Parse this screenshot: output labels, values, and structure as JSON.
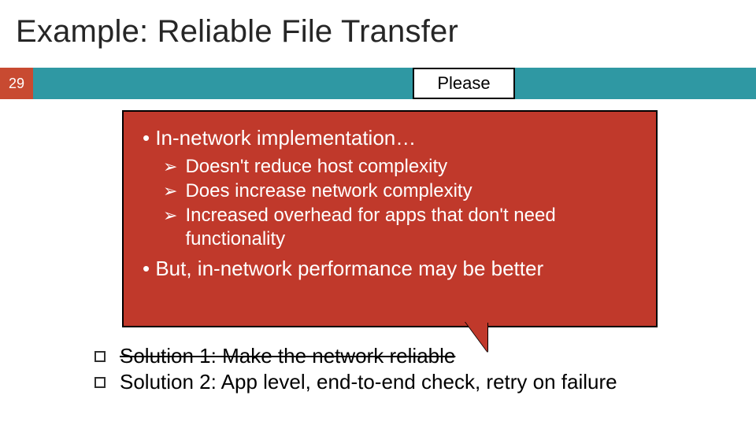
{
  "title": "Example: Reliable File Transfer",
  "slide_number": "29",
  "please_label": "Please",
  "callout": {
    "line1_prefix": "• ",
    "line1": "In-network implementation…",
    "bullets": [
      "Doesn't reduce host complexity",
      "Does increase network complexity",
      "Increased overhead for apps that don't need functionality"
    ],
    "line2_prefix": "• ",
    "line2": "But, in-network performance may be better"
  },
  "solutions": {
    "s1": "Solution 1: Make the network reliable",
    "s2": "Solution 2: App level, end-to-end check, retry on failure"
  },
  "glyphs": {
    "arrow": "➢"
  }
}
